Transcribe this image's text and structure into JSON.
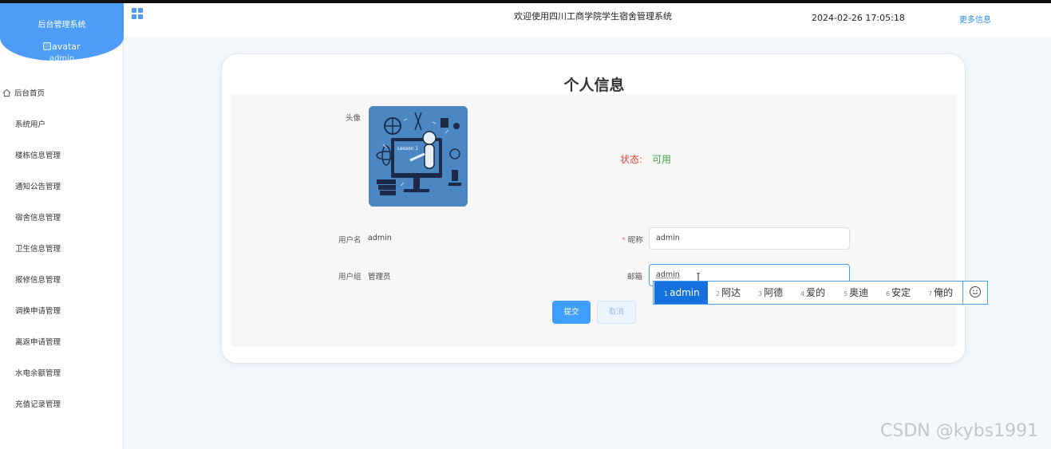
{
  "sidebar": {
    "title": "后台管理系统",
    "avatar_alt": "avatar",
    "username": "admin",
    "items": [
      {
        "label": "后台首页"
      },
      {
        "label": "系统用户"
      },
      {
        "label": "楼栋信息管理"
      },
      {
        "label": "通知公告管理"
      },
      {
        "label": "宿舍信息管理"
      },
      {
        "label": "卫生信息管理"
      },
      {
        "label": "报修信息管理"
      },
      {
        "label": "调换申请管理"
      },
      {
        "label": "离返申请管理"
      },
      {
        "label": "水电余额管理"
      },
      {
        "label": "充值记录管理"
      }
    ]
  },
  "header": {
    "title": "欢迎使用四川工商学院学生宿舍管理系统",
    "datetime": "2024-02-26 17:05:18",
    "more": "更多信息"
  },
  "profile": {
    "title": "个人信息",
    "avatar_label": "头像",
    "avatar_image_text": "Lesson 1",
    "status_label": "状态:",
    "status_value": "可用",
    "username_label": "用户名",
    "username_value": "admin",
    "group_label": "用户组",
    "group_value": "管理员",
    "nickname_label": "昵称",
    "nickname_value": "admin",
    "email_label": "邮箱",
    "email_value": "admin",
    "submit": "提交",
    "cancel": "取消"
  },
  "ime": {
    "candidates": [
      {
        "num": "1",
        "text": "admin"
      },
      {
        "num": "2",
        "text": "阿达"
      },
      {
        "num": "3",
        "text": "阿德"
      },
      {
        "num": "4",
        "text": "爱的"
      },
      {
        "num": "5",
        "text": "奥迪"
      },
      {
        "num": "6",
        "text": "安定"
      },
      {
        "num": "7",
        "text": "俺的"
      }
    ]
  },
  "watermark": "CSDN @kybs1991",
  "colors": {
    "accent": "#4c9cf8",
    "primary_button": "#409eff",
    "status_label": "#e4473a",
    "status_value": "#3aa63a"
  }
}
